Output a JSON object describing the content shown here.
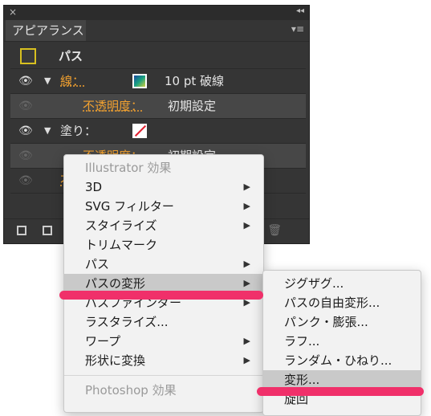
{
  "panel": {
    "tab_label": "アピアランス",
    "close_glyph": "×",
    "collapse_glyph": "◂◂",
    "menu_glyph": "▾≡",
    "rows": {
      "path_label": "パス",
      "stroke_label": "線：",
      "stroke_value": "10 pt 破線",
      "stroke_opacity_label": "不透明度：",
      "stroke_opacity_value": "初期設定",
      "fill_label": "塗り：",
      "fill_opacity_label": "不透明度：",
      "fill_opacity_value": "初期設定",
      "overall_opacity_label": "不"
    }
  },
  "menu_main": {
    "header": "Illustrator 効果",
    "items": [
      "3D",
      "SVG フィルター",
      "スタイライズ",
      "トリムマーク",
      "パス",
      "パスの変形",
      "パスファインダー",
      "ラスタライズ...",
      "ワープ",
      "形状に変換"
    ],
    "footer_header": "Photoshop 効果",
    "selected": "パスの変形"
  },
  "menu_sub": {
    "items": [
      "ジグザグ...",
      "パスの自由変形...",
      "パンク・膨張...",
      "ラフ...",
      "ランダム・ひねり...",
      "変形...",
      "旋回"
    ],
    "selected": "変形..."
  },
  "highlight_color": "#f0306a"
}
